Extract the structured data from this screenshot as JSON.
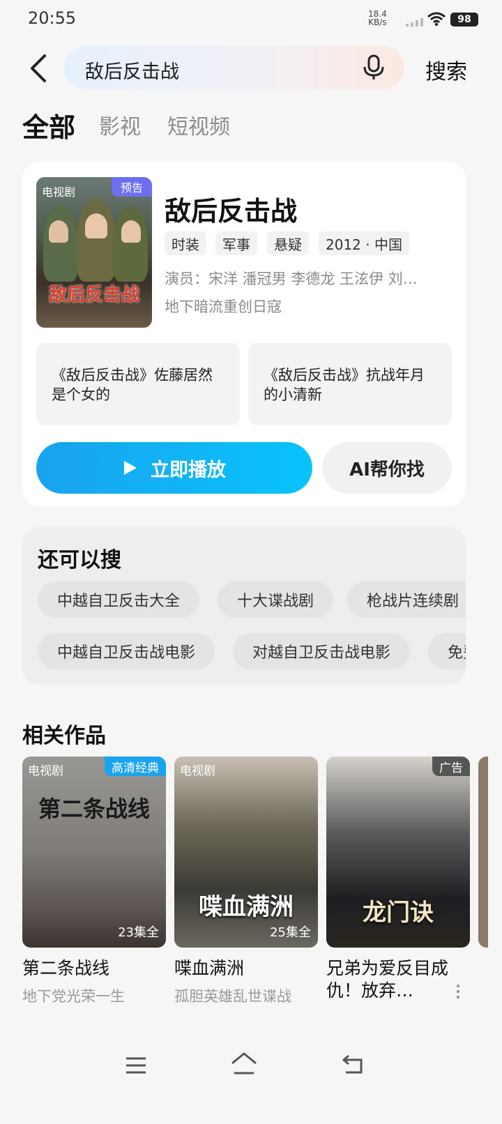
{
  "status_bar": {
    "time": "20:55",
    "speed_value": "18.4",
    "speed_unit": "KB/s",
    "battery": "98"
  },
  "header": {
    "search_query": "敌后反击战",
    "search_button": "搜索"
  },
  "tabs": [
    {
      "label": "全部"
    },
    {
      "label": "影视"
    },
    {
      "label": "短视频"
    }
  ],
  "main_result": {
    "poster_type": "电视剧",
    "poster_badge": "预告",
    "poster_title": "敌后反击战",
    "title": "敌后反击战",
    "tags": [
      "时装",
      "军事",
      "悬疑",
      "2012 · 中国"
    ],
    "actors": "演员：宋洋 潘冠男 李德龙 王泫伊 刘…",
    "tagline": "地下暗流重创日寇",
    "clips": [
      {
        "line1": "《敌后反击战》佐藤居然",
        "line2": "是个女的"
      },
      {
        "line1": "《敌后反击战》抗战年月",
        "line2": "的小清新"
      }
    ],
    "play_label": "立即播放",
    "ai_label": "AI帮你找"
  },
  "also_search": {
    "title": "还可以搜",
    "row1": [
      "中越自卫反击大全",
      "十大谍战剧",
      "枪战片连续剧"
    ],
    "row2": [
      "中越自卫反击战电影",
      "对越自卫反击战电影",
      "免费"
    ]
  },
  "related": {
    "title": "相关作品",
    "items": [
      {
        "type": "电视剧",
        "badge": "高清经典",
        "badge_color": "#1aa3ef",
        "poster_text": "第二条战线",
        "episodes": "23集全",
        "name": "第二条战线",
        "subtitle": "地下党光荣一生"
      },
      {
        "type": "电视剧",
        "badge": "",
        "badge_color": "",
        "poster_text": "喋血满洲",
        "episodes": "25集全",
        "name": "喋血满洲",
        "subtitle": "孤胆英雄乱世谍战"
      },
      {
        "type": "",
        "badge": "广告",
        "badge_color": "#555555",
        "poster_text": "龙门诀",
        "episodes": "",
        "name": "兄弟为爱反目成仇！放弃…",
        "subtitle": ""
      }
    ]
  },
  "colors": {
    "accent": "#1aa3ef",
    "badge_purple": "#6e6ef0"
  }
}
